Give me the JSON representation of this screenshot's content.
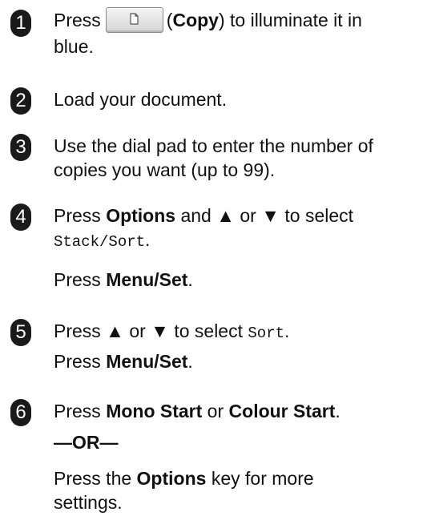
{
  "steps": [
    {
      "number": "1",
      "lines": [
        {
          "pre": "Press",
          "key_icon": "copy-key-icon",
          "post_open": "(",
          "bold": "Copy",
          "post": ") to illuminate it in"
        },
        {
          "text": "blue."
        }
      ]
    },
    {
      "number": "2",
      "text": "Load your document."
    },
    {
      "number": "3",
      "lines": [
        "Use the dial pad to enter the number of",
        "copies you want (up to 99)."
      ]
    },
    {
      "number": "4",
      "pre": "Press ",
      "bold": "Options",
      "mid": " and ▲ or ▼ to select",
      "mono": "Stack/Sort",
      "mono_after": ".",
      "sub_pre": "Press ",
      "sub_bold": "Menu/Set",
      "sub_post": "."
    },
    {
      "number": "5",
      "pre": "Press ▲ or ▼ to select ",
      "mono": "Sort",
      "mono_after": ".",
      "sub_pre": "Press ",
      "sub_bold": "Menu/Set",
      "sub_post": "."
    },
    {
      "number": "6",
      "pre": "Press ",
      "bold1": "Mono Start",
      "mid": " or ",
      "bold2": "Colour Start",
      "post": ".",
      "or_dash": "—",
      "or_word": "OR",
      "or_dash2": "—",
      "sub_pre": "Press the ",
      "sub_bold": "Options",
      "sub_post": " key for more",
      "sub_line2": "settings."
    }
  ]
}
